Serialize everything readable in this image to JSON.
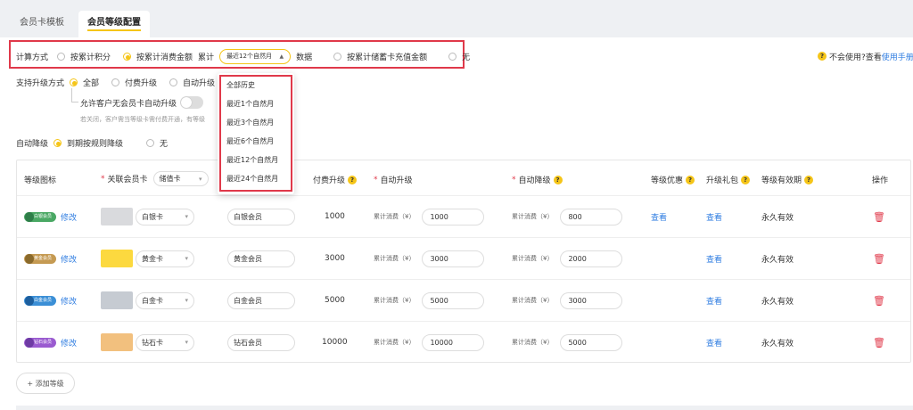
{
  "tabs": [
    {
      "label": "会员卡模板"
    },
    {
      "label": "会员等级配置"
    }
  ],
  "calc": {
    "label": "计算方式",
    "options": [
      "按累计积分",
      "按累计消费金额",
      "按累计储蓄卡充值金额",
      "无"
    ],
    "accumulate": "累计",
    "period_value": "最近12个自然月",
    "data_suffix": "数据"
  },
  "help": {
    "text": "不会使用?查看",
    "link": "使用手册"
  },
  "upgrade": {
    "label": "支持升级方式",
    "options": [
      "全部",
      "付费升级",
      "自动升级"
    ],
    "allow_text": "允许客户无会员卡自动升级",
    "hint": "若关闭，客户需当等级卡需付费开通，有等级"
  },
  "auto_downgrade": {
    "label": "自动降级",
    "options": [
      "到期按规则降级",
      "无"
    ]
  },
  "dropdown": {
    "items": [
      "全部历史",
      "最近1个自然月",
      "最近3个自然月",
      "最近6个自然月",
      "最近12个自然月",
      "最近24个自然月"
    ]
  },
  "table": {
    "headers": {
      "icon": "等级图标",
      "card": "关联会员卡",
      "card_filter": "储值卡",
      "paid": "付费升级",
      "auto_up": "自动升级",
      "auto_down": "自动降级",
      "benefit": "等级优惠",
      "gift": "升级礼包",
      "validity": "等级有效期",
      "ops": "操作"
    },
    "rows": [
      {
        "badge": "白银会员",
        "edit": "修改",
        "swatch": "#d9dadd",
        "card": "白银卡",
        "name": "白银会员",
        "paid": "1000",
        "up_label": "累计消费（¥）",
        "up": "1000",
        "down_label": "累计消费（¥）",
        "down": "800",
        "benefit": "查看",
        "gift": "查看",
        "validity": "永久有效"
      },
      {
        "badge": "黄金会员",
        "edit": "修改",
        "swatch": "#fcd93f",
        "card": "黄金卡",
        "name": "黄金会员",
        "paid": "3000",
        "up_label": "累计消费（¥）",
        "up": "3000",
        "down_label": "累计消费（¥）",
        "down": "2000",
        "benefit": "",
        "gift": "查看",
        "validity": "永久有效"
      },
      {
        "badge": "白金会员",
        "edit": "修改",
        "swatch": "#c6cbd2",
        "card": "白金卡",
        "name": "白金会员",
        "paid": "5000",
        "up_label": "累计消费（¥）",
        "up": "5000",
        "down_label": "累计消费（¥）",
        "down": "3000",
        "benefit": "",
        "gift": "查看",
        "validity": "永久有效"
      },
      {
        "badge": "钻石会员",
        "edit": "修改",
        "swatch": "#f2c07e",
        "card": "钻石卡",
        "name": "钻石会员",
        "paid": "10000",
        "up_label": "累计消费（¥）",
        "up": "10000",
        "down_label": "累计消费（¥）",
        "down": "5000",
        "benefit": "",
        "gift": "查看",
        "validity": "永久有效"
      }
    ]
  },
  "add_level": "+ 添加等级",
  "colors": {
    "accent": "#f5c518",
    "highlight": "#e0394a",
    "link": "#2f7de1"
  },
  "icons": {
    "help": "question-circle-icon",
    "dropdown": "chevron-down-icon",
    "delete": "trash-icon"
  }
}
